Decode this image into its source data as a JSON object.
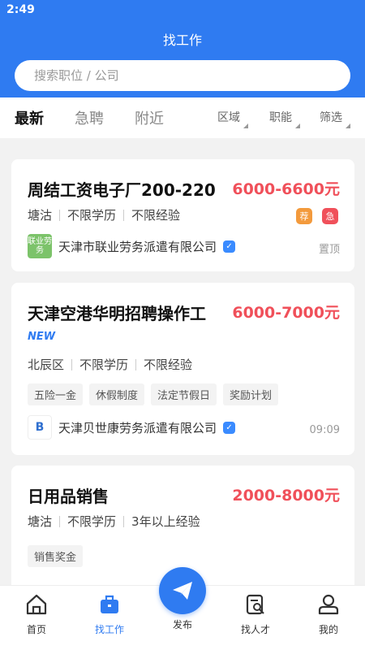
{
  "status_bar": {
    "time": "2:49"
  },
  "header": {
    "title": "找工作",
    "search_placeholder": "搜索职位 / 公司"
  },
  "tabs": [
    {
      "label": "最新",
      "active": true
    },
    {
      "label": "急聘",
      "active": false
    },
    {
      "label": "附近",
      "active": false
    }
  ],
  "filters": [
    {
      "label": "区域"
    },
    {
      "label": "职能"
    },
    {
      "label": "筛选"
    }
  ],
  "jobs": [
    {
      "title": "周结工资电子厂200-220",
      "salary": "6000-6600元",
      "location": "塘沽",
      "education": "不限学历",
      "experience": "不限经验",
      "company": "天津市联业劳务派遣有限公司",
      "logo_text": "联业劳务",
      "badges": [
        "荐",
        "急"
      ],
      "right_note": "置顶"
    },
    {
      "title": "天津空港华明招聘操作工",
      "new_tag": "NEW",
      "salary": "6000-7000元",
      "location": "北辰区",
      "education": "不限学历",
      "experience": "不限经验",
      "tags": [
        "五险一金",
        "休假制度",
        "法定节假日",
        "奖励计划"
      ],
      "company": "天津贝世康劳务派遣有限公司",
      "logo_text": "B",
      "right_note": "09:09"
    },
    {
      "title": "日用品销售",
      "salary": "2000-8000元",
      "location": "塘沽",
      "education": "不限学历",
      "experience": "3年以上经验",
      "tags": [
        "销售奖金"
      ]
    }
  ],
  "bottom_nav": [
    {
      "label": "首页",
      "icon": "home-icon"
    },
    {
      "label": "找工作",
      "icon": "briefcase-icon"
    },
    {
      "label": "发布",
      "icon": "paper-plane-icon"
    },
    {
      "label": "找人才",
      "icon": "talent-search-icon"
    },
    {
      "label": "我的",
      "icon": "profile-icon"
    }
  ],
  "colors": {
    "primary": "#2f7bf1",
    "salary": "#f0505a",
    "badge_recommend": "#f39a3c",
    "badge_urgent": "#f0505a"
  }
}
